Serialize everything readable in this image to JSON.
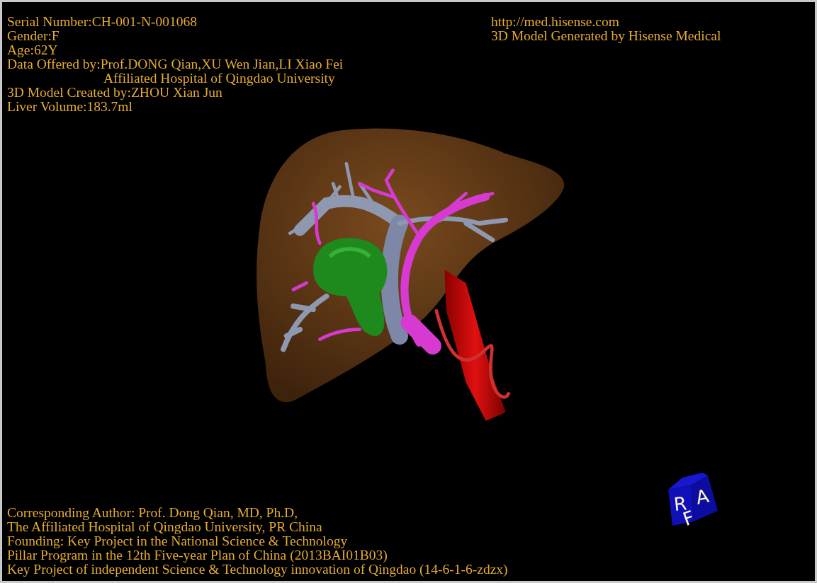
{
  "header_left": [
    {
      "text": "Serial Number:CH-001-N-001068",
      "kind": "plain"
    },
    {
      "text": "Gender:F",
      "kind": "plain"
    },
    {
      "text": "Age:62Y",
      "kind": "plain"
    },
    {
      "text": "Data Offered by:Prof.DONG Qian,XU Wen Jian,LI Xiao Fei",
      "kind": "plain"
    },
    {
      "text": "Affiliated Hospital of Qingdao University",
      "kind": "indented"
    },
    {
      "text": "3D Model Created by:ZHOU Xian Jun",
      "kind": "plain"
    },
    {
      "text": "Liver Volume:183.7ml",
      "kind": "plain"
    }
  ],
  "header_right": [
    {
      "text": "http://med.hisense.com"
    },
    {
      "text": "3D Model Generated by Hisense Medical"
    }
  ],
  "footer": [
    {
      "text": "Corresponding Author: Prof. Dong Qian, MD, Ph.D,"
    },
    {
      "text": "The Affiliated Hospital of Qingdao University, PR China"
    },
    {
      "text": "Founding: Key Project in the National Science & Technology"
    },
    {
      "text": "Pillar Program in the 12th Five-year Plan of China (2013BAI01B03)"
    },
    {
      "text": "Key Project of independent Science & Technology innovation of Qingdao (14-6-1-6-zdzx)"
    }
  ],
  "orientation_cube": {
    "faces": [
      "R",
      "A",
      "F"
    ]
  }
}
